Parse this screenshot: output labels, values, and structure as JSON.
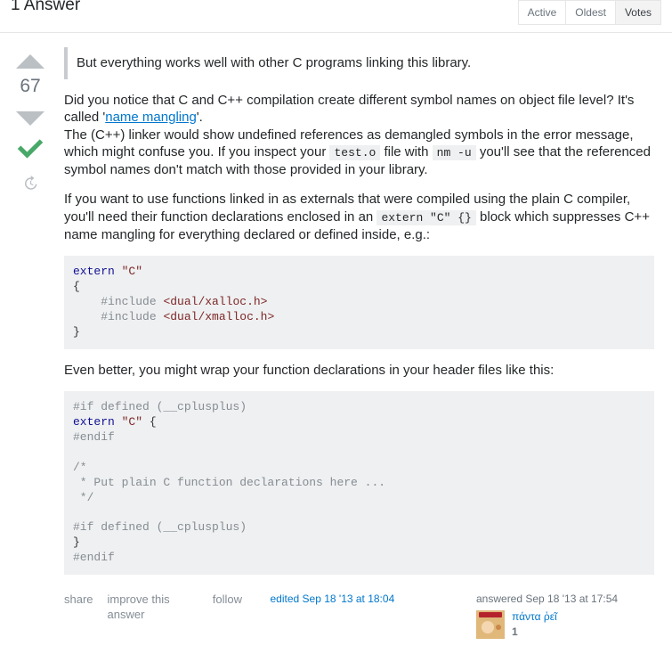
{
  "header": {
    "answer_count": "1 Answer",
    "tabs": {
      "active": "Active",
      "oldest": "Oldest",
      "votes": "Votes"
    }
  },
  "vote": {
    "score": "67"
  },
  "body": {
    "quote": "But everything works well with other C programs linking this library.",
    "p1_a": "Did you notice that C and C++ compilation create different symbol names on object file level? It's called '",
    "p1_link": "name mangling",
    "p1_b": "'.",
    "p1_c": "The (C++) linker would show undefined references as demangled symbols in the error message, which might confuse you. If you inspect your ",
    "p1_code1": "test.o",
    "p1_d": " file with ",
    "p1_code2": "nm -u",
    "p1_e": " you'll see that the referenced symbol names don't match with those provided in your library.",
    "p2_a": "If you want to use functions linked in as externals that were compiled using the plain C compiler, you'll need their function declarations enclosed in an ",
    "p2_code": "extern \"C\" {}",
    "p2_b": " block which suppresses C++ name mangling for everything declared or defined inside, e.g.:",
    "code1": {
      "l1_kw": "extern",
      "l1_str": "\"C\"",
      "l2": "{",
      "l3_kw": "#include",
      "l3_inc": "<dual/xalloc.h>",
      "l4_kw": "#include",
      "l4_inc": "<dual/xmalloc.h>",
      "l5": "}"
    },
    "p3": "Even better, you might wrap your function declarations in your header files like this:",
    "code2": {
      "l1": "#if defined (__cplusplus)",
      "l2_kw": "extern",
      "l2_str": "\"C\"",
      "l2_b": " {",
      "l3": "#endif",
      "l4": "",
      "l5": "/*",
      "l6": " * Put plain C function declarations here ...",
      "l7": " */",
      "l8": "",
      "l9": "#if defined (__cplusplus)",
      "l10": "}",
      "l11": "#endif"
    }
  },
  "menu": {
    "share": "share",
    "improve": "improve this answer",
    "follow": "follow"
  },
  "edited": {
    "label": "edited Sep 18 '13 at 18:04"
  },
  "user": {
    "action": "answered Sep 18 '13 at 17:54",
    "name": "πάντα ῥεῖ",
    "rep": "1"
  }
}
